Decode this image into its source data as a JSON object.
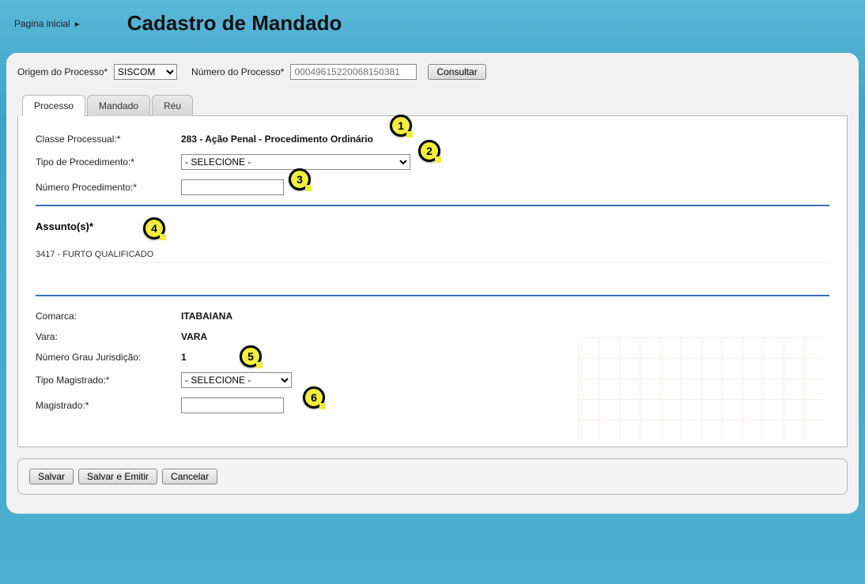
{
  "breadcrumb": {
    "home": "Pagina inicial"
  },
  "title": "Cadastro de Mandado",
  "topForm": {
    "origemLabel": "Origem do Processo*",
    "origemValue": "SISCOM",
    "numeroLabel": "Número do Processo*",
    "numeroPlaceholder": "00049615220068150381",
    "consultar": "Consultar"
  },
  "tabs": {
    "processo": "Processo",
    "mandado": "Mandado",
    "reu": "Réu"
  },
  "processo": {
    "classeLabel": "Classe Processual:*",
    "classeValue": "283 - Ação Penal - Procedimento Ordinário",
    "tipoProcLabel": "Tipo de Procedimento:*",
    "tipoProcValue": "- SELECIONE -",
    "numProcLabel": "Número Procedimento:*",
    "assuntoLabel": "Assunto(s)*",
    "assuntoValue": "3417 - FURTO QUALIFICADO",
    "comarcaLabel": "Comarca:",
    "comarcaValue": "ITABAIANA",
    "varaLabel": "Vara:",
    "varaValue": "VARA",
    "numGrauLabel": "Número Grau Jurisdição:",
    "numGrauValue": "1",
    "tipoMagLabel": "Tipo Magistrado:*",
    "tipoMagValue": "- SELECIONE -",
    "magLabel": "Magistrado:*"
  },
  "actions": {
    "salvar": "Salvar",
    "salvarEmitir": "Salvar e Emitir",
    "cancelar": "Cancelar"
  },
  "callouts": {
    "c1": "1",
    "c2": "2",
    "c3": "3",
    "c4": "4",
    "c5": "5",
    "c6": "6"
  }
}
